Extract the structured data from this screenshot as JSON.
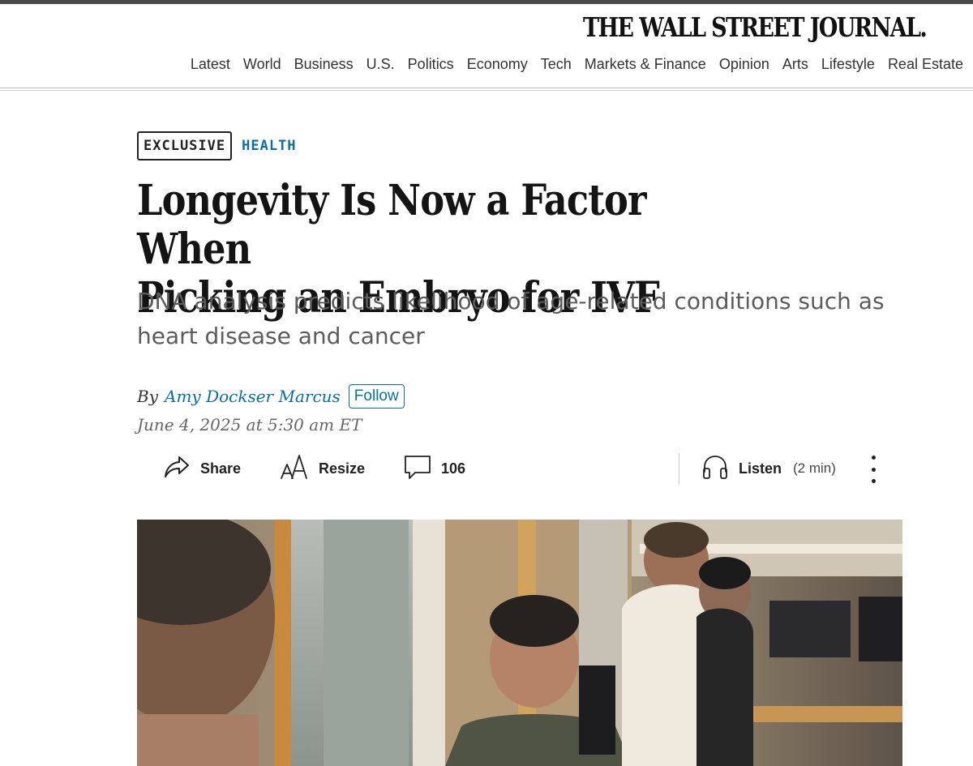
{
  "masthead": {
    "logo_text": "THE WALL STREET JOURNAL.",
    "nav": [
      "Latest",
      "World",
      "Business",
      "U.S.",
      "Politics",
      "Economy",
      "Tech",
      "Markets & Finance",
      "Opinion",
      "Arts",
      "Lifestyle",
      "Real Estate"
    ]
  },
  "article": {
    "flag": "EXCLUSIVE",
    "section": "HEALTH",
    "headline_line1": "Longevity Is Now a Factor When",
    "headline_line2": "Picking an Embryo for IVF",
    "dek": "DNA analysis predicts likelihood of age-related conditions such as heart disease and cancer",
    "byline_prefix": "By",
    "author": "Amy Dockser Marcus",
    "follow_label": "Follow",
    "timestamp": "June 4, 2025 at 5:30 am ET"
  },
  "toolbar": {
    "share_label": "Share",
    "resize_label": "Resize",
    "comments_count": "106",
    "listen_label": "Listen",
    "listen_duration": "(2 min)",
    "icons": [
      "share-icon",
      "resize-icon",
      "comment-icon",
      "headphones-icon",
      "more-icon"
    ]
  },
  "colors": {
    "accent_blue": "#0b6fa6",
    "headline": "#141414",
    "dek": "#5c5c5c"
  }
}
